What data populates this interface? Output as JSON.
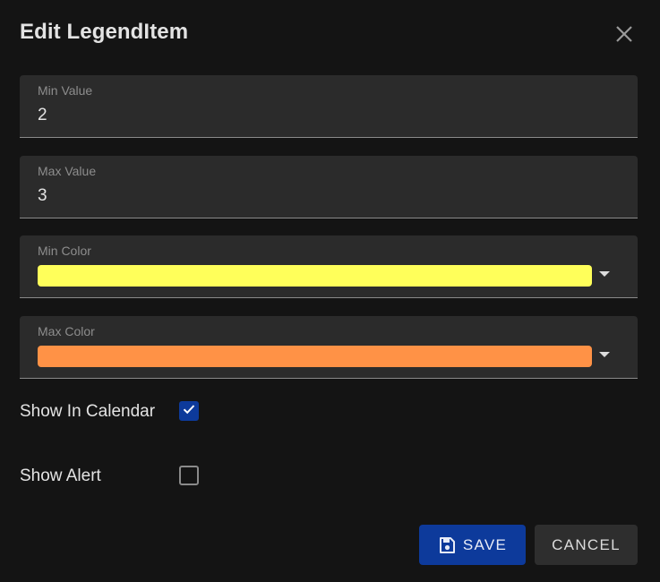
{
  "dialog": {
    "title": "Edit LegendItem"
  },
  "fields": {
    "min_value": {
      "label": "Min Value",
      "value": "2"
    },
    "max_value": {
      "label": "Max Value",
      "value": "3"
    },
    "min_color": {
      "label": "Min Color",
      "color": "#ffff5a"
    },
    "max_color": {
      "label": "Max Color",
      "color": "#ff9246"
    }
  },
  "checkboxes": {
    "show_in_calendar": {
      "label": "Show In Calendar",
      "checked": true
    },
    "show_alert": {
      "label": "Show Alert",
      "checked": false
    }
  },
  "actions": {
    "save_label": "SAVE",
    "cancel_label": "CANCEL"
  },
  "colors": {
    "background": "#141414",
    "field_background": "#2b2b2b",
    "accent": "#0d3a9b"
  }
}
